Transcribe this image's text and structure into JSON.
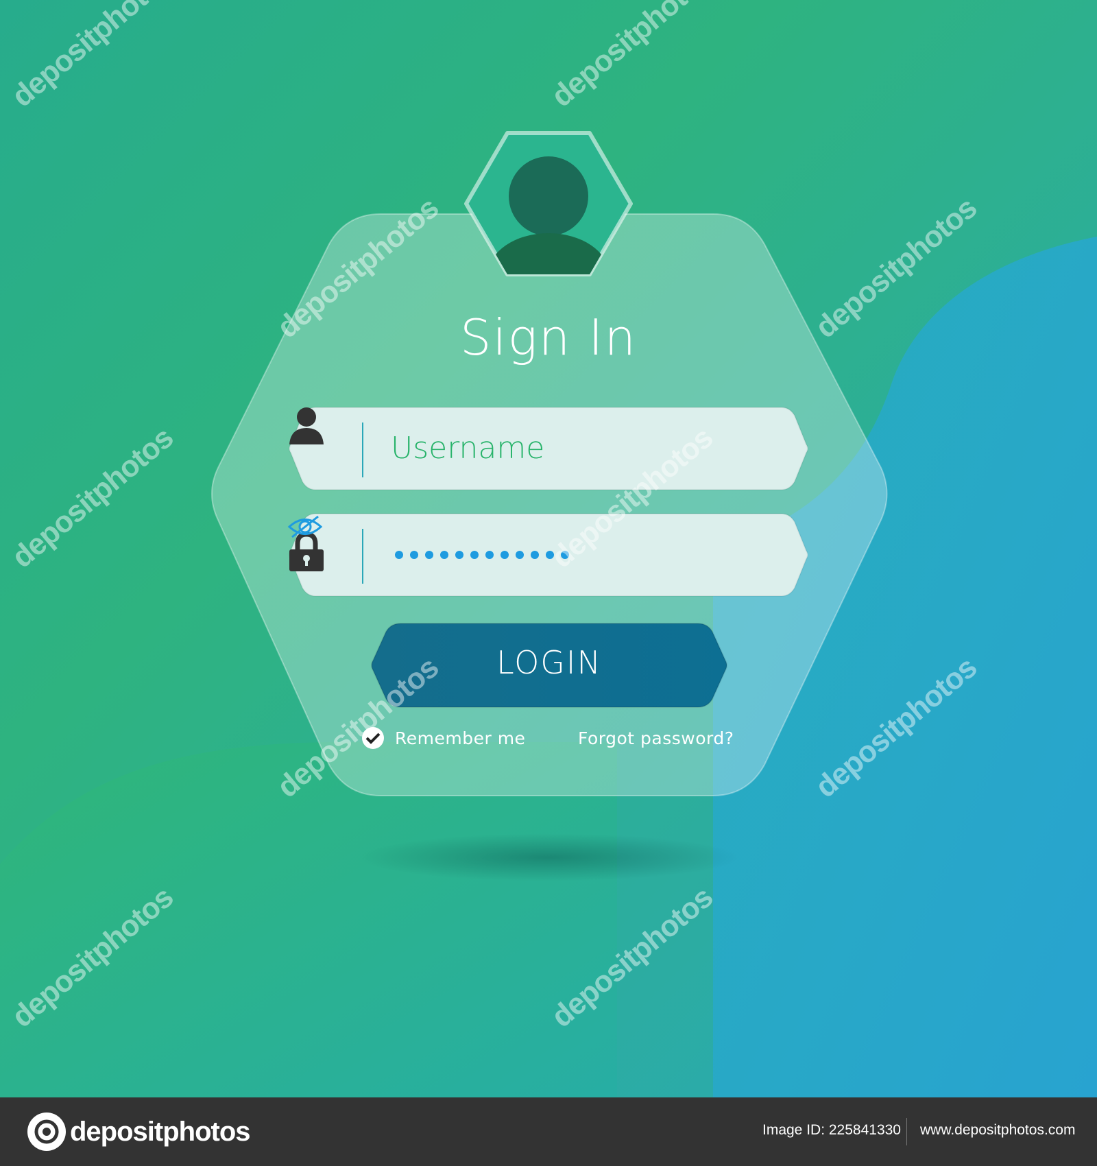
{
  "login_form": {
    "title": "Sign In",
    "username": {
      "placeholder": "Username",
      "icon": "user-icon"
    },
    "password": {
      "masked_value": "●●●●●●●●●●●●",
      "icon": "lock-icon",
      "toggle_icon": "eye-slash-icon"
    },
    "submit_label": "LOGIN",
    "remember_me": {
      "label": "Remember me",
      "checked": true
    },
    "forgot_password_label": "Forgot password?"
  },
  "watermark": {
    "text": "depositphotos"
  },
  "footer": {
    "brand": "depositphotos",
    "image_id_text": "Image ID: 225841330",
    "url": "www.depositphotos.com"
  },
  "colors": {
    "bg_green": "#2db37c",
    "bg_blue": "#29a6cc",
    "accent_green": "#27b36a",
    "login_button": "#0f6f8f",
    "footer_bg": "#333333"
  }
}
